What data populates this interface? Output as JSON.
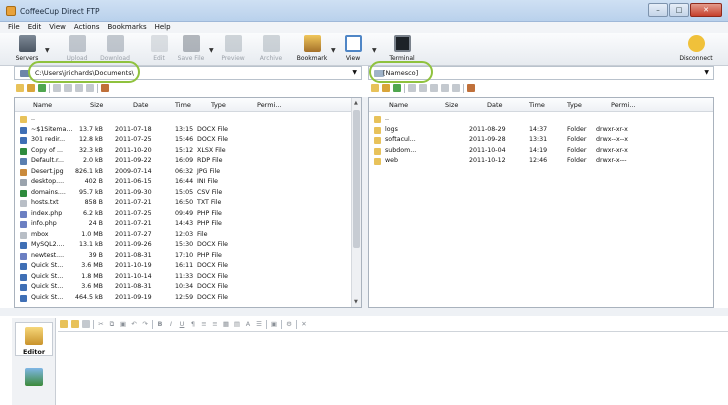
{
  "window": {
    "title": "CoffeeCup Direct FTP"
  },
  "menu": [
    "File",
    "Edit",
    "View",
    "Actions",
    "Bookmarks",
    "Help"
  ],
  "toolbar": {
    "servers": "Servers",
    "upload": "Upload",
    "download": "Download",
    "edit": "Edit",
    "save_file": "Save File",
    "preview": "Preview",
    "archive": "Archive",
    "bookmark": "Bookmark",
    "view": "View",
    "terminal": "Terminal",
    "disconnect": "Disconnect"
  },
  "local_path": "C:\\Users\\jrichards\\Documents\\",
  "remote_path": "[Namesco]",
  "columns": {
    "name": "Name",
    "size": "Size",
    "date": "Date",
    "time": "Time",
    "type": "Type",
    "perm": "Permi..."
  },
  "local_files": [
    {
      "name": "..",
      "size": "",
      "date": "",
      "time": "",
      "type": "",
      "icon": "parent"
    },
    {
      "name": "~$1Sitema...",
      "size": "13.7 kB",
      "date": "2011-07-18",
      "time": "13:15",
      "type": "DOCX File",
      "icon": "doc"
    },
    {
      "name": "301 redir...",
      "size": "12.8 kB",
      "date": "2011-07-25",
      "time": "15:46",
      "type": "DOCX File",
      "icon": "doc"
    },
    {
      "name": "Copy of ...",
      "size": "32.3 kB",
      "date": "2011-10-20",
      "time": "15:12",
      "type": "XLSX File",
      "icon": "xls"
    },
    {
      "name": "Default.r...",
      "size": "2.0 kB",
      "date": "2011-09-22",
      "time": "16:09",
      "type": "RDP File",
      "icon": "rdp"
    },
    {
      "name": "Desert.jpg",
      "size": "826.1 kB",
      "date": "2009-07-14",
      "time": "06:32",
      "type": "JPG File",
      "icon": "img"
    },
    {
      "name": "desktop....",
      "size": "402 B",
      "date": "2011-06-15",
      "time": "16:44",
      "type": "INI File",
      "icon": "ini"
    },
    {
      "name": "domains....",
      "size": "95.7 kB",
      "date": "2011-09-30",
      "time": "15:05",
      "type": "CSV File",
      "icon": "xls"
    },
    {
      "name": "hosts.txt",
      "size": "858 B",
      "date": "2011-07-21",
      "time": "16:50",
      "type": "TXT File",
      "icon": "txt"
    },
    {
      "name": "index.php",
      "size": "6.2 kB",
      "date": "2011-07-25",
      "time": "09:49",
      "type": "PHP File",
      "icon": "php"
    },
    {
      "name": "info.php",
      "size": "24 B",
      "date": "2011-07-21",
      "time": "14:43",
      "type": "PHP File",
      "icon": "php"
    },
    {
      "name": "mbox",
      "size": "1.0 MB",
      "date": "2011-07-27",
      "time": "12:03",
      "type": "File",
      "icon": "txt"
    },
    {
      "name": "MySQL2....",
      "size": "13.1 kB",
      "date": "2011-09-26",
      "time": "15:30",
      "type": "DOCX File",
      "icon": "doc"
    },
    {
      "name": "newtest....",
      "size": "39 B",
      "date": "2011-08-31",
      "time": "17:10",
      "type": "PHP File",
      "icon": "php"
    },
    {
      "name": "Quick St...",
      "size": "3.6 MB",
      "date": "2011-10-19",
      "time": "16:11",
      "type": "DOCX File",
      "icon": "doc"
    },
    {
      "name": "Quick St...",
      "size": "1.8 MB",
      "date": "2011-10-14",
      "time": "11:33",
      "type": "DOCX File",
      "icon": "doc"
    },
    {
      "name": "Quick St...",
      "size": "3.6 MB",
      "date": "2011-08-31",
      "time": "10:34",
      "type": "DOCX File",
      "icon": "doc"
    },
    {
      "name": "Quick St...",
      "size": "464.5 kB",
      "date": "2011-09-19",
      "time": "12:59",
      "type": "DOCX File",
      "icon": "doc"
    }
  ],
  "remote_files": [
    {
      "name": "..",
      "date": "",
      "time": "",
      "type": "",
      "perm": "",
      "icon": "parent"
    },
    {
      "name": "logs",
      "date": "2011-08-29",
      "time": "14:37",
      "type": "Folder",
      "perm": "drwxr-xr-x",
      "icon": "folder"
    },
    {
      "name": "softacul...",
      "date": "2011-09-28",
      "time": "13:31",
      "type": "Folder",
      "perm": "drwx--x--x",
      "icon": "folder"
    },
    {
      "name": "subdom...",
      "date": "2011-10-04",
      "time": "14:19",
      "type": "Folder",
      "perm": "drwxr-xr-x",
      "icon": "folder"
    },
    {
      "name": "web",
      "date": "2011-10-12",
      "time": "12:46",
      "type": "Folder",
      "perm": "drwxr-x---",
      "icon": "folder"
    }
  ],
  "editor": {
    "label": "Editor"
  },
  "colors": {
    "highlight": "#8fc23e",
    "folder": "#e8c25a"
  }
}
